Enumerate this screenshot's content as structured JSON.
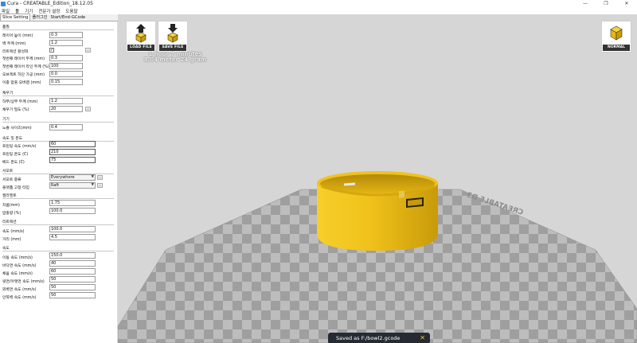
{
  "window": {
    "title": "Cura - CREATABLE_Edition_18.12.05",
    "controls": [
      "—",
      "❐",
      "✕"
    ]
  },
  "menu": [
    "파일",
    "툴",
    "기기",
    "전문가 설정",
    "도움말"
  ],
  "tabs": [
    "Slice Setting",
    "플러그인",
    "Start/End-GCode"
  ],
  "sections": {
    "quality": {
      "title": "품질",
      "rows": [
        {
          "label": "레이어 높이 (mm)",
          "value": "0.3"
        },
        {
          "label": "벽 두께 (mm)",
          "value": "1.2"
        },
        {
          "label": "리트랙션 활성화",
          "value": "✓"
        },
        {
          "label": "첫번째 레이어 두께 (mm)",
          "value": "0.3"
        },
        {
          "label": "첫번째 레이어 라인 두께 (%)",
          "value": "100"
        },
        {
          "label": "오브젝트 하단 가공 (mm)",
          "value": "0.0"
        },
        {
          "label": "이중 압출 오버랩 (mm)",
          "value": "0.15"
        }
      ]
    },
    "fill": {
      "title": "채우기",
      "rows": [
        {
          "label": "하부/상부 두께 (mm)",
          "value": "1.2"
        },
        {
          "label": "채우기 밀도 (%)",
          "value": "20"
        }
      ]
    },
    "machine": {
      "title": "기기",
      "rows": [
        {
          "label": "노즐 사이즈(mm)",
          "value": "0.4"
        }
      ]
    },
    "speed_temp": {
      "title": "속도 및 온도",
      "rows": [
        {
          "label": "프린팅 속도 (mm/s)",
          "value": "60"
        },
        {
          "label": "프린팅 온도 (C)",
          "value": "210"
        },
        {
          "label": "베드 온도 (C)",
          "value": "75"
        }
      ]
    },
    "support": {
      "title": "서포트",
      "rows": [
        {
          "label": "서포트 종류",
          "value": "Everywhere"
        },
        {
          "label": "플랫폼 고정 타입",
          "value": "Raft"
        }
      ]
    },
    "filament": {
      "title": "필라멘트",
      "rows": [
        {
          "label": "지름(mm)",
          "value": "1.75"
        },
        {
          "label": "압출량 (%)",
          "value": "100.0"
        }
      ]
    },
    "retraction": {
      "title": "리트랙션",
      "rows": [
        {
          "label": "속도 (mm/s)",
          "value": "100.0"
        },
        {
          "label": "거리 (mm)",
          "value": "4.5"
        }
      ]
    },
    "speed": {
      "title": "속도",
      "rows": [
        {
          "label": "이동 속도 (mm/s)",
          "value": "150.0"
        },
        {
          "label": "바닥면 속도 (mm/s)",
          "value": "40"
        },
        {
          "label": "채움 속도 (mm/s)",
          "value": "60"
        },
        {
          "label": "윗면/아랫면 속도 (mm/s)",
          "value": "50"
        },
        {
          "label": "외벽면 속도 (mm/s)",
          "value": "50"
        },
        {
          "label": "안쪽벽 속도 (mm/s)",
          "value": "50"
        }
      ]
    }
  },
  "viewport": {
    "load_label": "LOAD FILE",
    "save_label": "SAVE FILE",
    "view_label": "NORMAL",
    "print_time": "1 hour 7 minutes",
    "print_material": "8.04 meter 24 gram",
    "bed_label": "CREATABLE D3",
    "toast": "Saved as F:/bowl2.gcode"
  },
  "colors": {
    "object": "#f2c21b",
    "toast_bg": "#262a32",
    "button_label_bg": "#333333"
  }
}
